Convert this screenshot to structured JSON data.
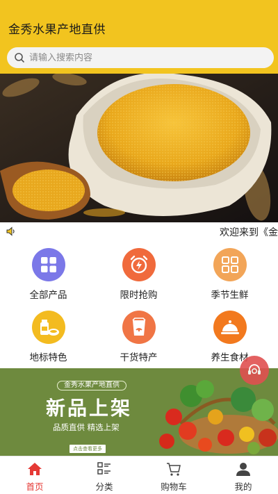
{
  "header": {
    "title": "金秀水果产地直供",
    "search_placeholder": "请输入搜索内容",
    "color": "#f2c41f"
  },
  "notice": {
    "icon": "speaker-icon",
    "text": "欢迎来到《金"
  },
  "categories": [
    {
      "label": "全部产品",
      "icon": "grid-icon",
      "color": "#7b78e8"
    },
    {
      "label": "限时抢购",
      "icon": "alarm-clock-icon",
      "color": "#f06a3c"
    },
    {
      "label": "季节生鲜",
      "icon": "four-squares-icon",
      "color": "#f2a558"
    },
    {
      "label": "地标特色",
      "icon": "groceries-icon",
      "color": "#f3bb20"
    },
    {
      "label": "干货特产",
      "icon": "package-icon",
      "color": "#f07545"
    },
    {
      "label": "养生食材",
      "icon": "food-cloche-icon",
      "color": "#f2791e"
    }
  ],
  "ad": {
    "brand": "金秀水果产地直供",
    "headline": "新品上架",
    "slogan": "品质直供  精选上架",
    "cta": "点击查看更多"
  },
  "float_button": {
    "icon": "customer-service-icon"
  },
  "tabbar": [
    {
      "label": "首页",
      "icon": "home-icon",
      "active": true
    },
    {
      "label": "分类",
      "icon": "category-list-icon",
      "active": false
    },
    {
      "label": "购物车",
      "icon": "cart-icon",
      "active": false
    },
    {
      "label": "我的",
      "icon": "user-icon",
      "active": false
    }
  ]
}
